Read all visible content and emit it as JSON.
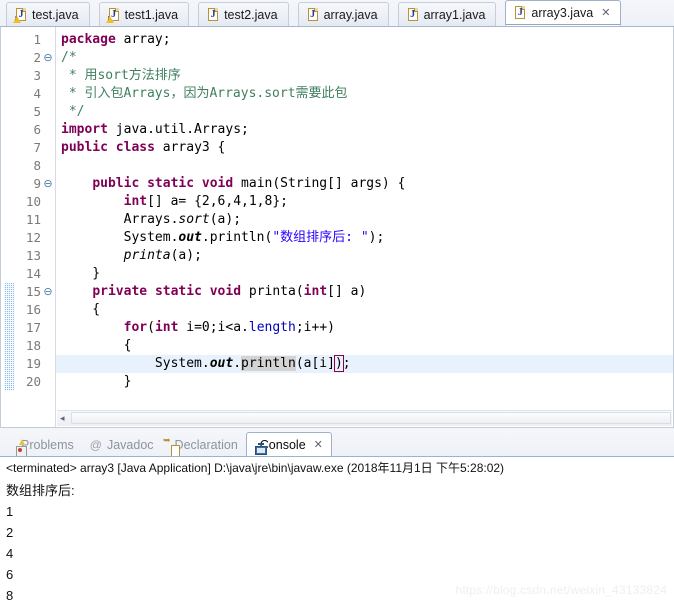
{
  "editor": {
    "tabs": [
      {
        "label": "test.java",
        "icon": "java-file-warning-icon",
        "active": false,
        "warning": true
      },
      {
        "label": "test1.java",
        "icon": "java-file-warning-icon",
        "active": false,
        "warning": true
      },
      {
        "label": "test2.java",
        "icon": "java-file-icon",
        "active": false,
        "warning": false
      },
      {
        "label": "array.java",
        "icon": "java-file-icon",
        "active": false,
        "warning": false
      },
      {
        "label": "array1.java",
        "icon": "java-file-icon",
        "active": false,
        "warning": false
      },
      {
        "label": "array3.java",
        "icon": "java-file-icon",
        "active": true,
        "warning": false,
        "close_icon": "✕"
      }
    ],
    "lines": [
      {
        "n": "1",
        "fold": "",
        "html": "<span class=\"kw\">package</span> array;"
      },
      {
        "n": "2",
        "fold": "⊖",
        "html": "<span class=\"cmt\">/*</span>"
      },
      {
        "n": "3",
        "fold": "",
        "html": "<span class=\"cmt\"> * 用sort方法排序</span>"
      },
      {
        "n": "4",
        "fold": "",
        "html": "<span class=\"cmt\"> * 引入包Arrays，因为Arrays.sort需要此包</span>"
      },
      {
        "n": "5",
        "fold": "",
        "html": "<span class=\"cmt\"> */</span>"
      },
      {
        "n": "6",
        "fold": "",
        "html": "<span class=\"kw\">import</span> java.util.Arrays;"
      },
      {
        "n": "7",
        "fold": "",
        "html": "<span class=\"kw\">public</span> <span class=\"kw\">class</span> array3 {"
      },
      {
        "n": "8",
        "fold": "",
        "html": ""
      },
      {
        "n": "9",
        "fold": "⊖",
        "html": "    <span class=\"kw\">public</span> <span class=\"kw\">static</span> <span class=\"kw\">void</span> main(String[] args) {"
      },
      {
        "n": "10",
        "fold": "",
        "html": "        <span class=\"kw\">int</span>[] a= {2,6,4,1,8};"
      },
      {
        "n": "11",
        "fold": "",
        "html": "        Arrays.<span class=\"mth\">sort</span>(a);"
      },
      {
        "n": "12",
        "fold": "",
        "html": "        System.<span class=\"stc\">out</span>.println(<span class=\"str\">\"数组排序后: \"</span>);"
      },
      {
        "n": "13",
        "fold": "",
        "html": "        <span class=\"mth\">printa</span>(a);"
      },
      {
        "n": "14",
        "fold": "",
        "html": "    }"
      },
      {
        "n": "15",
        "fold": "⊖",
        "html": "    <span class=\"kw\">private</span> <span class=\"kw\">static</span> <span class=\"kw\">void</span> printa(<span class=\"kw\">int</span>[] a)"
      },
      {
        "n": "16",
        "fold": "",
        "html": "    {"
      },
      {
        "n": "17",
        "fold": "",
        "html": "        <span class=\"kw\">for</span>(<span class=\"kw\">int</span> i=0;i&lt;a.<span class=\"fld\">length</span>;i++)"
      },
      {
        "n": "18",
        "fold": "",
        "html": "        {"
      },
      {
        "n": "19",
        "fold": "",
        "html": "            System.<span class=\"stc\">out</span>.<span class=\"occ\">println</span>(a[i]<span class=\"brk\">)</span>;"
      },
      {
        "n": "20",
        "fold": "",
        "html": "        }"
      }
    ],
    "highlight_line_index": 18,
    "change_bar_from_index": 14,
    "change_bar_to_index": 19,
    "hscroll_left_arrow": "◂"
  },
  "console": {
    "tabs": [
      {
        "label": "Problems",
        "icon": "problems-icon",
        "active": false
      },
      {
        "label": "Javadoc",
        "icon": "javadoc-at-icon",
        "active": false
      },
      {
        "label": "Declaration",
        "icon": "declaration-icon",
        "active": false
      },
      {
        "label": "Console",
        "icon": "console-monitor-icon",
        "active": true,
        "close_icon": "✕"
      }
    ],
    "terminated_line": "<terminated> array3 [Java Application] D:\\java\\jre\\bin\\javaw.exe (2018年11月1日 下午5:28:02)",
    "output": [
      "数组排序后:",
      "1",
      "2",
      "4",
      "6",
      "8"
    ]
  },
  "watermark": "https://blog.csdn.net/weixin_43133824",
  "colors": {
    "keyword": "#7f0055",
    "string": "#2a00ff",
    "comment": "#3f7f5f",
    "field": "#0000c0",
    "highlight_line": "#e8f2fc",
    "occurrence": "#d4d4d4",
    "change_bar": "#8cbfe8"
  }
}
